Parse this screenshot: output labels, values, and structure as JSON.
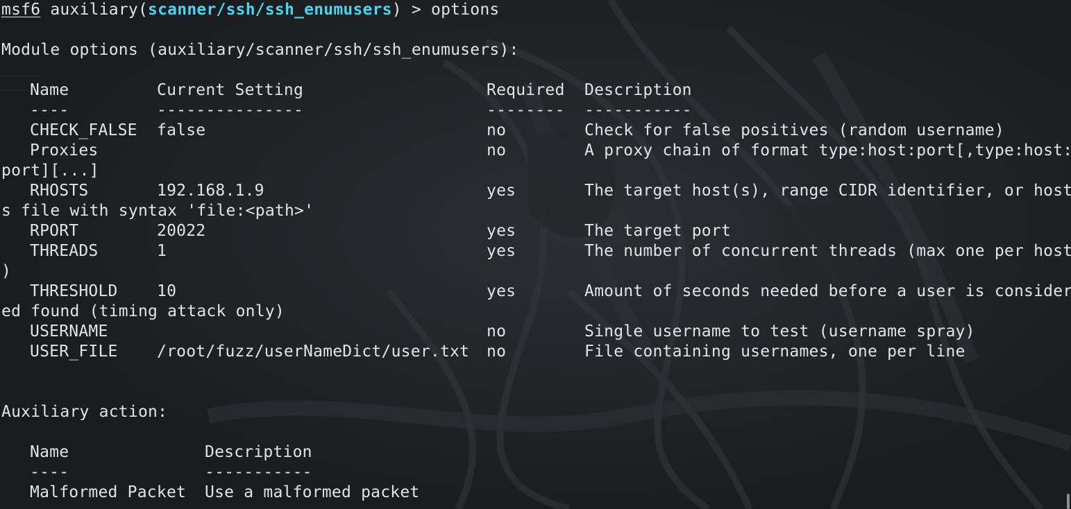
{
  "prompt": {
    "host": "msf6",
    "type": "auxiliary",
    "module": "scanner/ssh/ssh_enumusers",
    "command": "options"
  },
  "module_options_header": "Module options (auxiliary/scanner/ssh/ssh_enumusers):",
  "options_table": {
    "headers": [
      "Name",
      "Current Setting",
      "Required",
      "Description"
    ],
    "separators": [
      "----",
      "---------------",
      "--------",
      "-----------"
    ],
    "rows": [
      {
        "name": "CHECK_FALSE",
        "setting": "false",
        "required": "no",
        "description": "Check for false positives (random username)",
        "wrap": ""
      },
      {
        "name": "Proxies",
        "setting": "",
        "required": "no",
        "description": "A proxy chain of format type:host:port[,type:host:",
        "wrap": "port][...]"
      },
      {
        "name": "RHOSTS",
        "setting": "192.168.1.9",
        "required": "yes",
        "description": "The target host(s), range CIDR identifier, or host",
        "wrap": "s file with syntax 'file:<path>'"
      },
      {
        "name": "RPORT",
        "setting": "20022",
        "required": "yes",
        "description": "The target port",
        "wrap": ""
      },
      {
        "name": "THREADS",
        "setting": "1",
        "required": "yes",
        "description": "The number of concurrent threads (max one per host",
        "wrap": ")"
      },
      {
        "name": "THRESHOLD",
        "setting": "10",
        "required": "yes",
        "description": "Amount of seconds needed before a user is consider",
        "wrap": "ed found (timing attack only)"
      },
      {
        "name": "USERNAME",
        "setting": "",
        "required": "no",
        "description": "Single username to test (username spray)",
        "wrap": ""
      },
      {
        "name": "USER_FILE",
        "setting": "/root/fuzz/userNameDict/user.txt",
        "required": "no",
        "description": "File containing usernames, one per line",
        "wrap": ""
      }
    ]
  },
  "auxiliary_action_header": "Auxiliary action:",
  "action_table": {
    "headers": [
      "Name",
      "Description"
    ],
    "separators": [
      "----",
      "-----------"
    ],
    "rows": [
      {
        "name": "Malformed Packet",
        "description": "Use a malformed packet"
      }
    ]
  },
  "colors": {
    "background": "#1e2023",
    "text": "#e1e3e6",
    "module_accent": "#4ed3ee"
  }
}
